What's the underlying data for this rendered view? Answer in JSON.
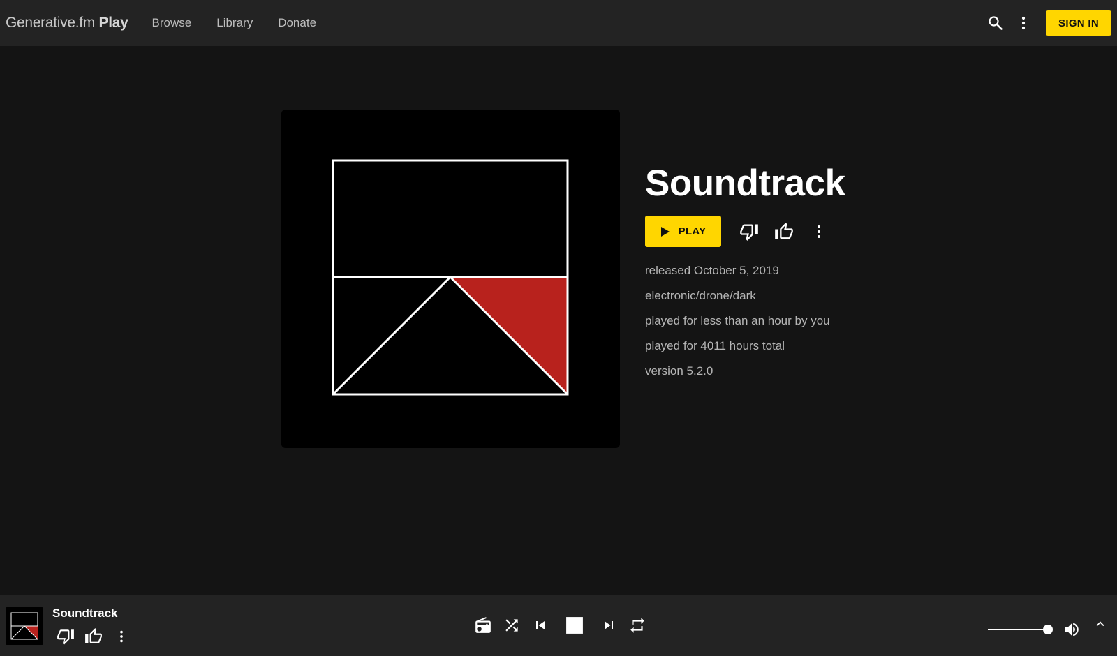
{
  "app": {
    "brand_name": "Generative.fm",
    "brand_suffix": "Play"
  },
  "nav": {
    "items": [
      "Browse",
      "Library",
      "Donate"
    ]
  },
  "header": {
    "search_icon": "search-icon",
    "more_icon": "more-vert-icon",
    "sign_in_label": "SIGN IN"
  },
  "piece": {
    "title": "Soundtrack",
    "play_label": "PLAY",
    "released": "released October 5, 2019",
    "tags": "electronic/drone/dark",
    "played_by_you": "played for less than an hour by you",
    "played_total": "played for 4011 hours total",
    "version": "version 5.2.0"
  },
  "player": {
    "now_playing_title": "Soundtrack",
    "volume_level": 0.94,
    "controls": [
      "radio-icon",
      "shuffle-icon",
      "skip-previous-icon",
      "stop-icon",
      "skip-next-icon",
      "repeat-icon"
    ]
  },
  "colors": {
    "accent": "#ffd600",
    "art_red": "#b8221d",
    "background": "#141414",
    "bar": "#232323"
  }
}
